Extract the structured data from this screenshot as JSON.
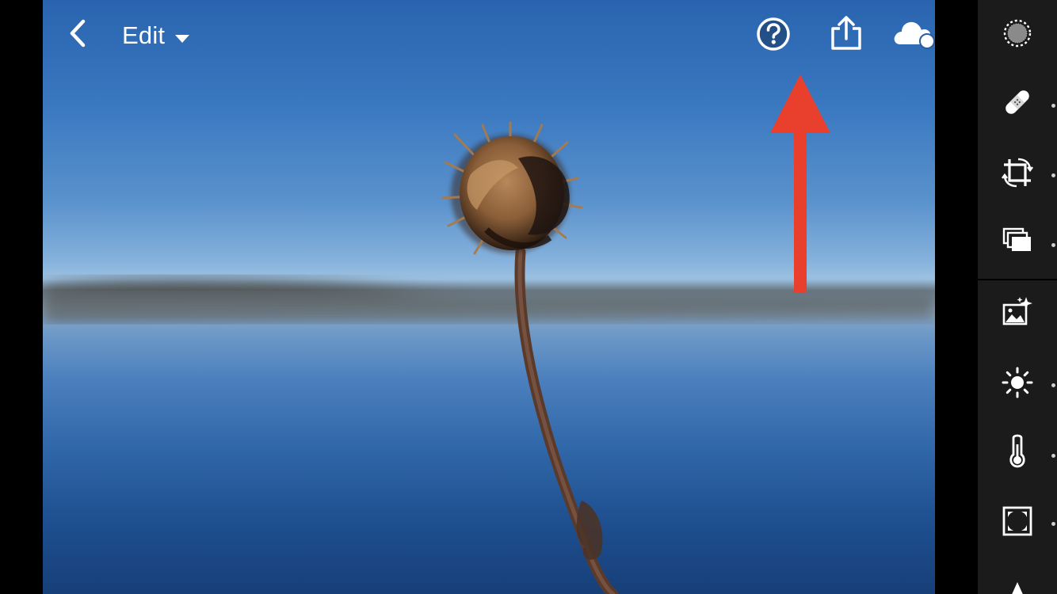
{
  "header": {
    "edit_label": "Edit"
  },
  "icons": {
    "back": "chevron-left-icon",
    "edit_dropdown": "caret-down-icon",
    "help": "question-circle-icon",
    "share": "share-icon",
    "cloud": "cloud-sync-icon",
    "more": "more-dots-icon"
  },
  "tools": [
    {
      "name": "selective",
      "icon": "selective-brush-icon"
    },
    {
      "name": "healing",
      "icon": "bandage-icon"
    },
    {
      "name": "crop",
      "icon": "crop-rotate-icon"
    },
    {
      "name": "presets",
      "icon": "presets-icon"
    },
    {
      "name": "auto",
      "icon": "auto-enhance-icon"
    },
    {
      "name": "light",
      "icon": "sun-icon"
    },
    {
      "name": "color",
      "icon": "thermometer-icon"
    },
    {
      "name": "effects",
      "icon": "vignette-frame-icon"
    },
    {
      "name": "detail",
      "icon": "triangle-icon"
    }
  ],
  "colors": {
    "annotation_arrow": "#e8402c",
    "panel_bg": "#1b1b1b",
    "icon": "#ffffff"
  }
}
